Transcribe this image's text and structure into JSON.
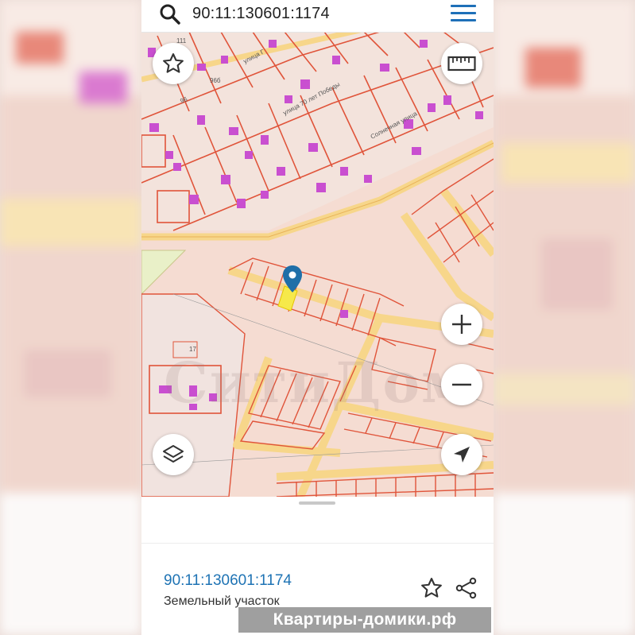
{
  "search": {
    "query": "90:11:130601:1174"
  },
  "map": {
    "street_labels": [
      "улица 70 лет Победы",
      "улица Г",
      "Солнечная улица"
    ],
    "house_numbers": [
      "111",
      "96",
      "96б",
      "17"
    ],
    "map_watermark": "СитиДом"
  },
  "controls": {
    "favorite": "star-icon",
    "ruler": "ruler-icon",
    "zoom_in": "plus-icon",
    "zoom_out": "minus-icon",
    "layers": "layers-icon",
    "locate": "navigation-icon"
  },
  "sheet": {
    "cadastral_number": "90:11:130601:1174",
    "object_type": "Земельный участок"
  },
  "watermark": "Квартиры-домики.рф",
  "colors": {
    "accent": "#1e70b8",
    "parcel_border": "#e0543a",
    "road": "#f7d68a",
    "building": "#c94fd0",
    "selected": "#f6e94a"
  }
}
